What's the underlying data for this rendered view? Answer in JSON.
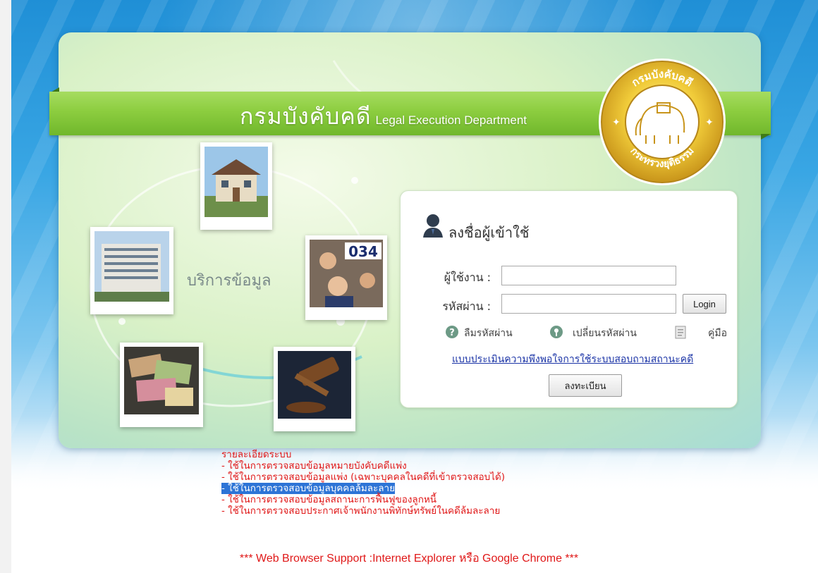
{
  "banner": {
    "title_thai": "กรมบังคับคดี",
    "title_english": "Legal Execution Department"
  },
  "seal": {
    "top_text": "กรมบังคับคดี",
    "bottom_text": "กระทรวงยุติธรรม"
  },
  "services": {
    "label": "บริการข้อมูล",
    "photo_number": "034"
  },
  "login": {
    "title": "ลงชื่อผู้เข้าใช้",
    "username_label": "ผู้ใช้งาน :",
    "username_value": "",
    "password_label": "รหัสผ่าน :",
    "password_value": "",
    "login_button": "Login",
    "forgot_password": "ลืมรหัสผ่าน",
    "change_password": "เปลี่ยนรหัสผ่าน",
    "manual": "คู่มือ",
    "survey_link": "แบบประเมินความพึงพอใจการใช้ระบบสอบถามสถานะคดี",
    "register_button": "ลงทะเบียน"
  },
  "details": {
    "heading": "รายละเอียดระบบ",
    "items": [
      "- ใช้ในการตรวจสอบข้อมูลหมายบังคับคดีแพ่ง",
      "- ใช้ในการตรวจสอบข้อมูลแพ่ง (เฉพาะบุคคลในคดีที่เข้าตรวจสอบได้)",
      "- ใช้ในการตรวจสอบข้อมูลบุคคลล้มละลาย",
      "- ใช้ในการตรวจสอบข้อมูลสถานะการฟื้นฟูของลูกหนี้",
      "- ใช้ในการตรวจสอบประกาศเจ้าพนักงานพิทักษ์ทรัพย์ในคดีล้มละลาย"
    ],
    "selected_index": 2
  },
  "footer": {
    "support_text": "*** Web Browser Support :Internet Explorer หรือ Google Chrome ***"
  },
  "colors": {
    "accent_green": "#8ccd3f",
    "link_blue": "#1a33a6",
    "detail_red": "#e01818",
    "seal_gold": "#e6b81e",
    "selection_blue": "#2d74d6"
  }
}
